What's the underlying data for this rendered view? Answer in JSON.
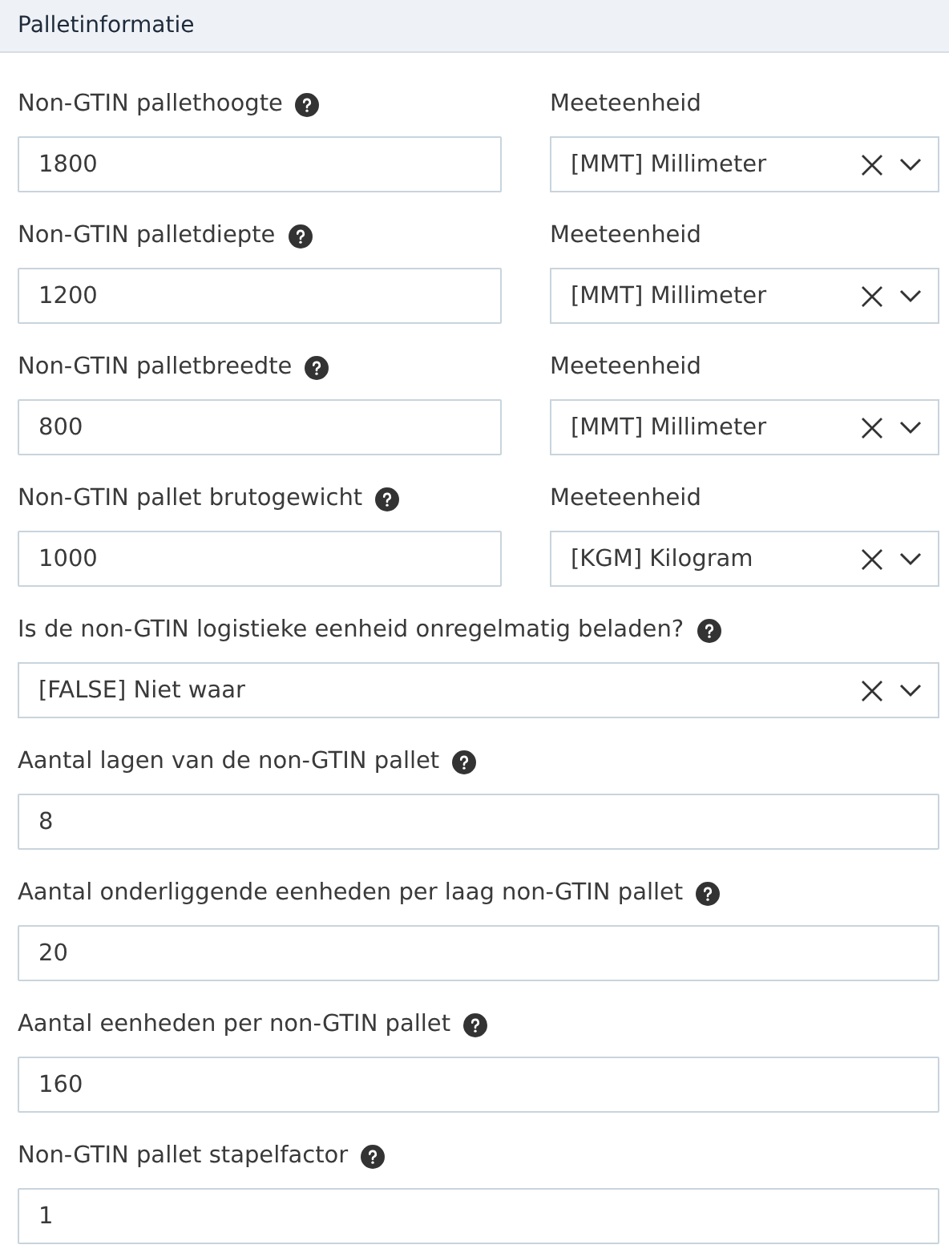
{
  "header": {
    "title": "Palletinformatie"
  },
  "fields": [
    {
      "kind": "measure",
      "label": "Non-GTIN pallethoogte",
      "value": "1800",
      "unit_label": "Meeteenheid",
      "unit": "[MMT] Millimeter"
    },
    {
      "kind": "measure",
      "label": "Non-GTIN palletdiepte",
      "value": "1200",
      "unit_label": "Meeteenheid",
      "unit": "[MMT] Millimeter"
    },
    {
      "kind": "measure",
      "label": "Non-GTIN palletbreedte",
      "value": "800",
      "unit_label": "Meeteenheid",
      "unit": "[MMT] Millimeter"
    },
    {
      "kind": "measure",
      "label": "Non-GTIN pallet brutogewicht",
      "value": "1000",
      "unit_label": "Meeteenheid",
      "unit": "[KGM] Kilogram"
    },
    {
      "kind": "select",
      "label": "Is de non-GTIN logistieke eenheid onregelmatig beladen?",
      "value": "[FALSE] Niet waar"
    },
    {
      "kind": "text",
      "label": "Aantal lagen van de non-GTIN pallet",
      "value": "8"
    },
    {
      "kind": "text",
      "label": "Aantal onderliggende eenheden per laag non-GTIN pallet",
      "value": "20"
    },
    {
      "kind": "text",
      "label": "Aantal eenheden per non-GTIN pallet",
      "value": "160"
    },
    {
      "kind": "text",
      "label": "Non-GTIN pallet stapelfactor",
      "value": "1"
    }
  ]
}
